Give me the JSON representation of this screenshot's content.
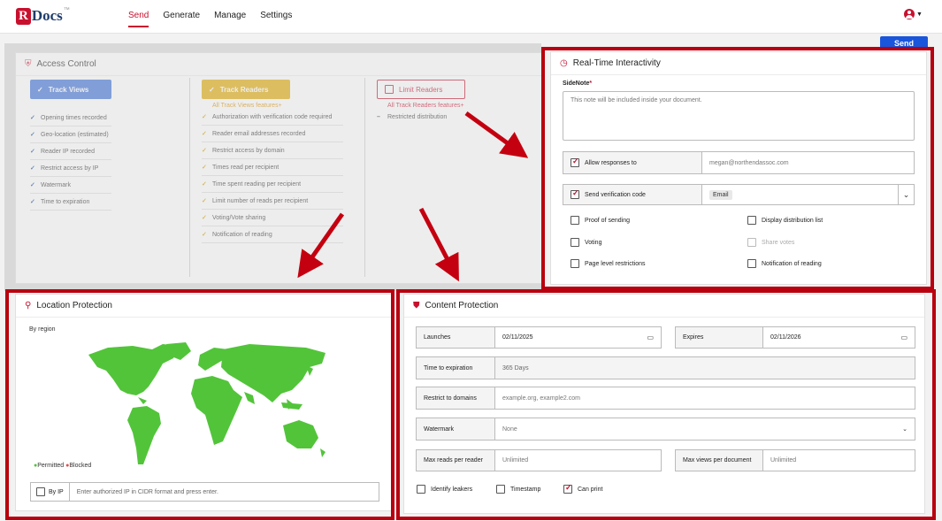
{
  "brand": {
    "logo_mark": "R",
    "logo_text": "Docs"
  },
  "nav": [
    {
      "label": "Send",
      "active": true
    },
    {
      "label": "Generate"
    },
    {
      "label": "Manage"
    },
    {
      "label": "Settings"
    }
  ],
  "user_menu": {
    "icon": "user-circle-icon"
  },
  "send_button": "Send",
  "access_control": {
    "title": "Access Control",
    "columns": [
      {
        "button": "Track Views",
        "color": "#3a6fd8",
        "features_link": "",
        "items": [
          "Opening times recorded",
          "Geo-location (estimated)",
          "Reader IP recorded",
          "Restrict access by IP",
          "Watermark",
          "Time to expiration"
        ]
      },
      {
        "button": "Track Readers",
        "color": "#e0a800",
        "features_link": "All Track Views features+",
        "items": [
          "Authorization with verification code required",
          "Reader email addresses recorded",
          "Restrict access by domain",
          "Times read per recipient",
          "Time spent reading per recipient",
          "Limit number of reads per recipient",
          "Voting/Vote sharing",
          "Notification of reading"
        ]
      },
      {
        "button": "Limit Readers",
        "color": "#c8102e",
        "features_link": "All Track Readers features+",
        "items": [
          "Restricted distribution"
        ]
      }
    ]
  },
  "realtime": {
    "title": "Real-Time Interactivity",
    "sidenote_label": "SideNote",
    "sidenote_required": "*",
    "sidenote_placeholder": "This note will be included inside your document.",
    "allow_responses_label": "Allow responses to",
    "allow_responses_email": "megan@northendassoc.com",
    "send_code_label": "Send verification code",
    "send_code_value": "Email",
    "options": [
      {
        "label": "Proof of sending",
        "checked": false,
        "disabled": false
      },
      {
        "label": "Display distribution list",
        "checked": false,
        "disabled": false
      },
      {
        "label": "Voting",
        "checked": false,
        "disabled": false
      },
      {
        "label": "Share votes",
        "checked": false,
        "disabled": true
      },
      {
        "label": "Page level restrictions",
        "checked": false,
        "disabled": false
      },
      {
        "label": "Notification of reading",
        "checked": false,
        "disabled": false
      }
    ]
  },
  "location": {
    "title": "Location Protection",
    "by_region": "By region",
    "legend_permitted": "Permitted",
    "legend_blocked": "Blocked",
    "by_ip_label": "By IP",
    "ip_placeholder": "Enter authorized IP in CIDR format and press enter.",
    "map_color": "#52c43a"
  },
  "content": {
    "title": "Content Protection",
    "launches_label": "Launches",
    "launches_value": "02/11/2025",
    "expires_label": "Expires",
    "expires_value": "02/11/2026",
    "time_exp_label": "Time to expiration",
    "time_exp_value": "365 Days",
    "domains_label": "Restrict to domains",
    "domains_placeholder": "example.org, example2.com",
    "watermark_label": "Watermark",
    "watermark_value": "None",
    "max_reads_label": "Max reads per reader",
    "max_reads_value": "Unlimited",
    "max_views_label": "Max views per document",
    "max_views_value": "Unlimited",
    "checks": [
      {
        "label": "Identify leakers",
        "checked": false
      },
      {
        "label": "Timestamp",
        "checked": false
      },
      {
        "label": "Can print",
        "checked": true
      }
    ]
  },
  "highlight_color": "#b8000f"
}
